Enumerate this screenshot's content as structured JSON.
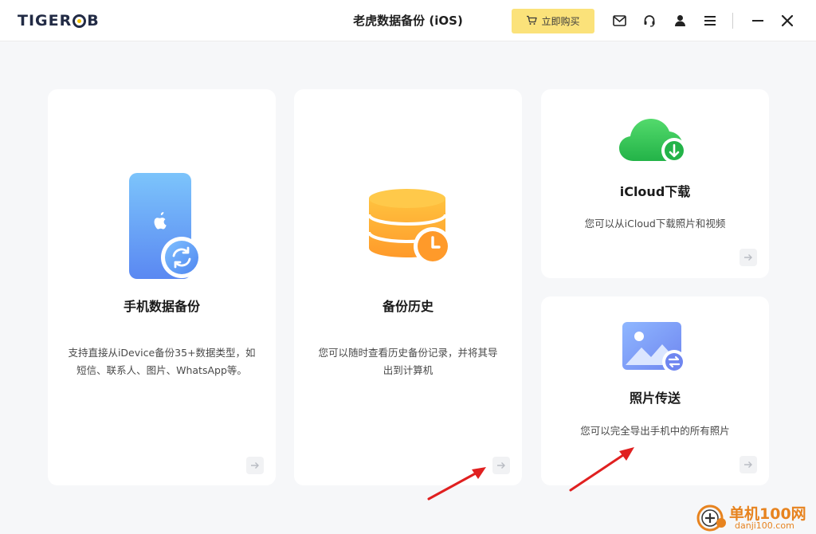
{
  "header": {
    "logo_text_a": "TIGER",
    "logo_text_b": "B",
    "title": "老虎数据备份 (iOS)",
    "buy_label": "立即购买"
  },
  "toolbar_icons": [
    "mail-icon",
    "headset-icon",
    "user-icon",
    "menu-icon",
    "minimize-icon",
    "close-icon"
  ],
  "cards": {
    "backup": {
      "title": "手机数据备份",
      "desc_line1": "支持直接从iDevice备份35+数据类型，如",
      "desc_line2": "短信、联系人、图片、WhatsApp等。"
    },
    "history": {
      "title": "备份历史",
      "desc_line1": "您可以随时查看历史备份记录，并将其导",
      "desc_line2": "出到计算机"
    },
    "icloud": {
      "title": "iCloud下载",
      "desc": "您可以从iCloud下载照片和视频"
    },
    "photo": {
      "title": "照片传送",
      "desc": "您可以完全导出手机中的所有照片"
    }
  },
  "watermark": {
    "text": "单机100网",
    "url": "danji100.com"
  },
  "colors": {
    "accent_yellow": "#fbe27a",
    "background": "#f6f7f9",
    "annotation_red": "#e02020"
  }
}
